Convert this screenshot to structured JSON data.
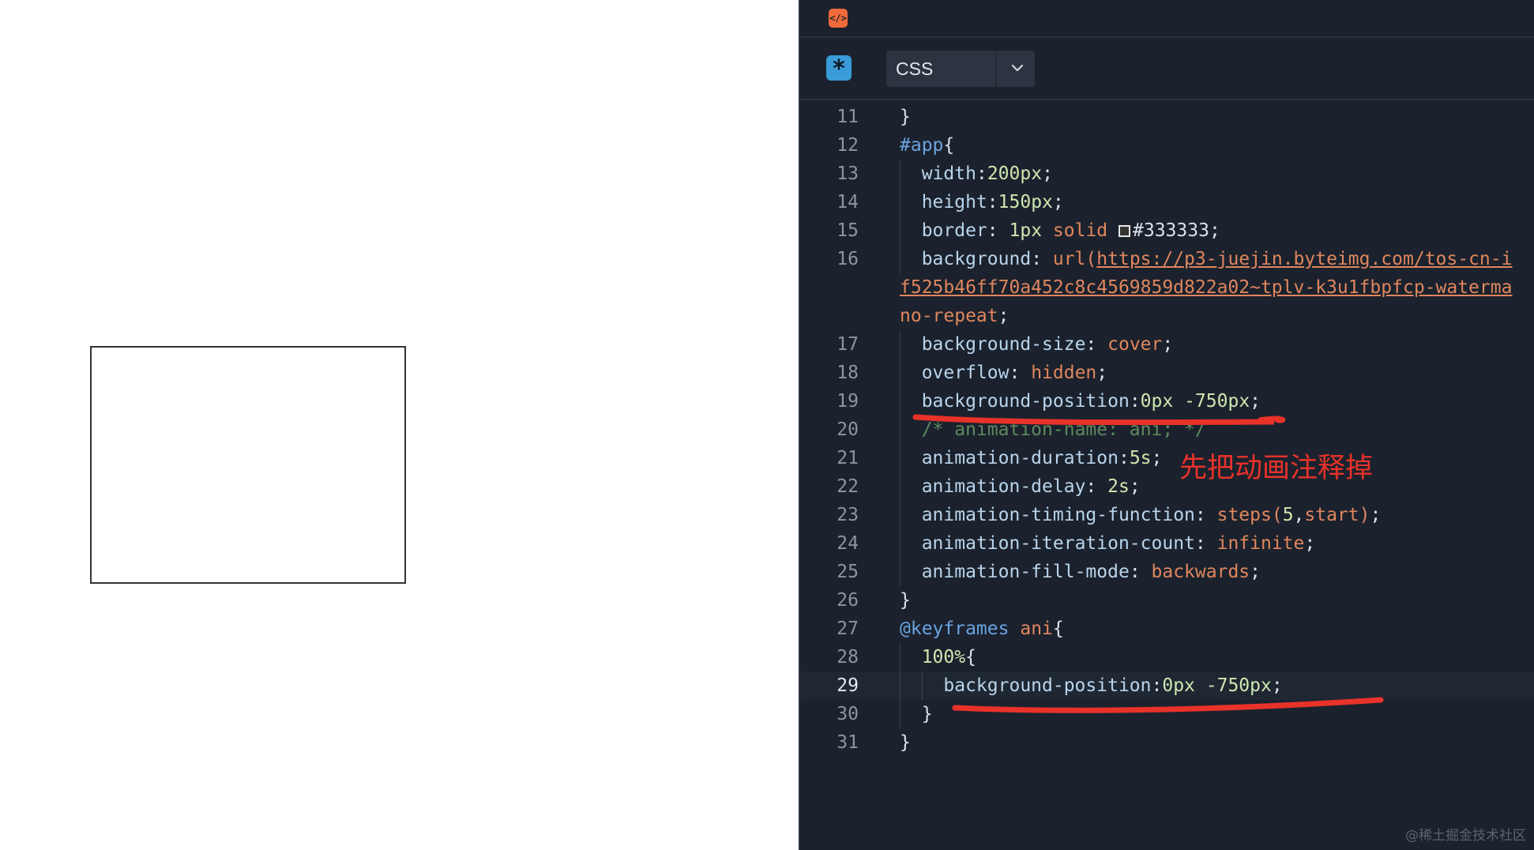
{
  "editor": {
    "language": "CSS",
    "annotation": "先把动画注释掉",
    "watermark": "@稀土掘金技术社区",
    "lines": [
      {
        "n": "11",
        "tokens": [
          {
            "t": "}",
            "c": "punct"
          }
        ]
      },
      {
        "n": "12",
        "tokens": [
          {
            "t": "#app",
            "c": "sel"
          },
          {
            "t": "{",
            "c": "punct"
          }
        ]
      },
      {
        "n": "13",
        "tokens": [
          {
            "t": "  "
          },
          {
            "t": "width",
            "c": "prop"
          },
          {
            "t": ":",
            "c": "punct"
          },
          {
            "t": "200px",
            "c": "num"
          },
          {
            "t": ";",
            "c": "punct"
          }
        ]
      },
      {
        "n": "14",
        "tokens": [
          {
            "t": "  "
          },
          {
            "t": "height",
            "c": "prop"
          },
          {
            "t": ":",
            "c": "punct"
          },
          {
            "t": "150px",
            "c": "num"
          },
          {
            "t": ";",
            "c": "punct"
          }
        ]
      },
      {
        "n": "15",
        "tokens": [
          {
            "t": "  "
          },
          {
            "t": "border",
            "c": "prop"
          },
          {
            "t": ": ",
            "c": "punct"
          },
          {
            "t": "1px",
            "c": "num"
          },
          {
            "t": " "
          },
          {
            "t": "solid",
            "c": "val"
          },
          {
            "t": " "
          },
          {
            "swatch": "#333333"
          },
          {
            "t": "#333333",
            "c": "punct"
          },
          {
            "t": ";",
            "c": "punct"
          }
        ]
      },
      {
        "n": "16",
        "tokens": [
          {
            "t": "  "
          },
          {
            "t": "background",
            "c": "prop"
          },
          {
            "t": ": ",
            "c": "punct"
          },
          {
            "t": "url(",
            "c": "val"
          },
          {
            "t": "https://p3-juejin.byteimg.com/tos-cn-i",
            "c": "url"
          }
        ]
      },
      {
        "n": "",
        "wrap": true,
        "tokens": [
          {
            "t": "f525b46ff70a452c8c4569859d822a02~tplv-k3u1fbpfcp-waterma",
            "c": "url"
          }
        ]
      },
      {
        "n": "",
        "wrap": true,
        "tokens": [
          {
            "t": "no-repeat",
            "c": "val"
          },
          {
            "t": ";",
            "c": "punct"
          }
        ]
      },
      {
        "n": "17",
        "tokens": [
          {
            "t": "  "
          },
          {
            "t": "background-size",
            "c": "prop"
          },
          {
            "t": ": ",
            "c": "punct"
          },
          {
            "t": "cover",
            "c": "val"
          },
          {
            "t": ";",
            "c": "punct"
          }
        ]
      },
      {
        "n": "18",
        "tokens": [
          {
            "t": "  "
          },
          {
            "t": "overflow",
            "c": "prop"
          },
          {
            "t": ": ",
            "c": "punct"
          },
          {
            "t": "hidden",
            "c": "val"
          },
          {
            "t": ";",
            "c": "punct"
          }
        ]
      },
      {
        "n": "19",
        "tokens": [
          {
            "t": "  "
          },
          {
            "t": "background-position",
            "c": "prop"
          },
          {
            "t": ":",
            "c": "punct"
          },
          {
            "t": "0px",
            "c": "num"
          },
          {
            "t": " "
          },
          {
            "t": "-750px",
            "c": "num"
          },
          {
            "t": ";",
            "c": "punct"
          }
        ]
      },
      {
        "n": "20",
        "tokens": [
          {
            "t": "  "
          },
          {
            "t": "/* animation-name: ani; */",
            "c": "comment"
          }
        ]
      },
      {
        "n": "21",
        "tokens": [
          {
            "t": "  "
          },
          {
            "t": "animation-duration",
            "c": "prop"
          },
          {
            "t": ":",
            "c": "punct"
          },
          {
            "t": "5s",
            "c": "num"
          },
          {
            "t": ";",
            "c": "punct"
          }
        ]
      },
      {
        "n": "22",
        "tokens": [
          {
            "t": "  "
          },
          {
            "t": "animation-delay",
            "c": "prop"
          },
          {
            "t": ": ",
            "c": "punct"
          },
          {
            "t": "2s",
            "c": "num"
          },
          {
            "t": ";",
            "c": "punct"
          }
        ]
      },
      {
        "n": "23",
        "tokens": [
          {
            "t": "  "
          },
          {
            "t": "animation-timing-function",
            "c": "prop"
          },
          {
            "t": ": ",
            "c": "punct"
          },
          {
            "t": "steps(",
            "c": "val"
          },
          {
            "t": "5",
            "c": "num"
          },
          {
            "t": ",",
            "c": "punct"
          },
          {
            "t": "start",
            "c": "val"
          },
          {
            "t": ")",
            "c": "val"
          },
          {
            "t": ";",
            "c": "punct"
          }
        ]
      },
      {
        "n": "24",
        "tokens": [
          {
            "t": "  "
          },
          {
            "t": "animation-iteration-count",
            "c": "prop"
          },
          {
            "t": ": ",
            "c": "punct"
          },
          {
            "t": "infinite",
            "c": "val"
          },
          {
            "t": ";",
            "c": "punct"
          }
        ]
      },
      {
        "n": "25",
        "tokens": [
          {
            "t": "  "
          },
          {
            "t": "animation-fill-mode",
            "c": "prop"
          },
          {
            "t": ": ",
            "c": "punct"
          },
          {
            "t": "backwards",
            "c": "val"
          },
          {
            "t": ";",
            "c": "punct"
          }
        ]
      },
      {
        "n": "26",
        "tokens": [
          {
            "t": "}",
            "c": "punct"
          }
        ]
      },
      {
        "n": "27",
        "tokens": [
          {
            "t": "@keyframes",
            "c": "sel"
          },
          {
            "t": " "
          },
          {
            "t": "ani",
            "c": "val"
          },
          {
            "t": "{",
            "c": "punct"
          }
        ]
      },
      {
        "n": "28",
        "tokens": [
          {
            "t": "  "
          },
          {
            "t": "100%",
            "c": "num"
          },
          {
            "t": "{",
            "c": "punct"
          }
        ]
      },
      {
        "n": "29",
        "active": true,
        "tokens": [
          {
            "t": "    "
          },
          {
            "t": "background-position",
            "c": "prop"
          },
          {
            "t": ":",
            "c": "punct"
          },
          {
            "t": "0px",
            "c": "num"
          },
          {
            "t": " "
          },
          {
            "t": "-750px",
            "c": "num"
          },
          {
            "t": ";",
            "c": "punct"
          }
        ]
      },
      {
        "n": "30",
        "tokens": [
          {
            "t": "  "
          },
          {
            "t": "}",
            "c": "punct"
          }
        ]
      },
      {
        "n": "31",
        "tokens": [
          {
            "t": "}",
            "c": "punct"
          }
        ]
      }
    ]
  },
  "colors": {
    "annotation_red": "#e8322a",
    "editor_bg": "#1b222d"
  }
}
